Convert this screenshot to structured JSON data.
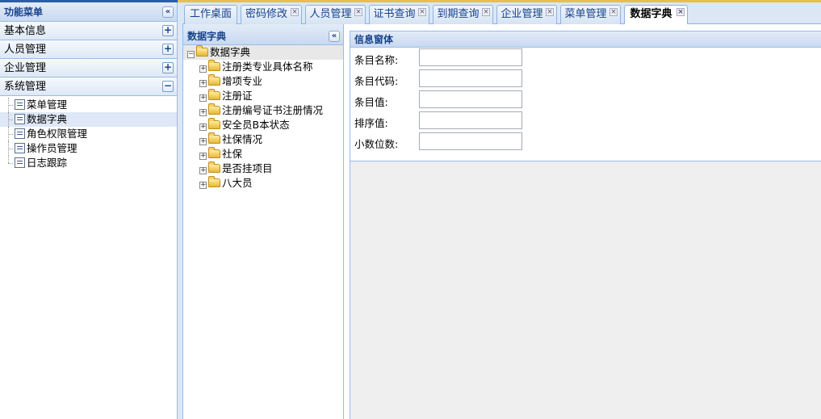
{
  "left_menu": {
    "title": "功能菜单",
    "groups": [
      {
        "label": "基本信息",
        "toggle": "+"
      },
      {
        "label": "人员管理",
        "toggle": "+"
      },
      {
        "label": "企业管理",
        "toggle": "+"
      },
      {
        "label": "系统管理",
        "toggle": "−"
      }
    ],
    "items": [
      {
        "label": "菜单管理"
      },
      {
        "label": "数据字典"
      },
      {
        "label": "角色权限管理"
      },
      {
        "label": "操作员管理"
      },
      {
        "label": "日志跟踪"
      }
    ],
    "collapse_glyph": "«"
  },
  "tabs": [
    {
      "label": "工作桌面"
    },
    {
      "label": "密码修改"
    },
    {
      "label": "人员管理"
    },
    {
      "label": "证书查询"
    },
    {
      "label": "到期查询"
    },
    {
      "label": "企业管理"
    },
    {
      "label": "菜单管理"
    },
    {
      "label": "数据字典"
    }
  ],
  "tab_close_glyph": "×",
  "dict_panel": {
    "title": "数据字典",
    "root": "数据字典",
    "root_toggle": "−",
    "node_toggle": "+",
    "nodes": [
      "注册类专业具体名称",
      "增项专业",
      "注册证",
      "注册编号证书注册情况",
      "安全员B本状态",
      "社保情况",
      "社保",
      "是否挂项目",
      "八大员"
    ]
  },
  "info_panel": {
    "title": "信息窗体",
    "fields": [
      {
        "label": "条目名称:",
        "value": ""
      },
      {
        "label": "条目代码:",
        "value": ""
      },
      {
        "label": "条目值:",
        "value": ""
      },
      {
        "label": "排序值:",
        "value": ""
      },
      {
        "label": "小数位数:",
        "value": ""
      }
    ]
  }
}
